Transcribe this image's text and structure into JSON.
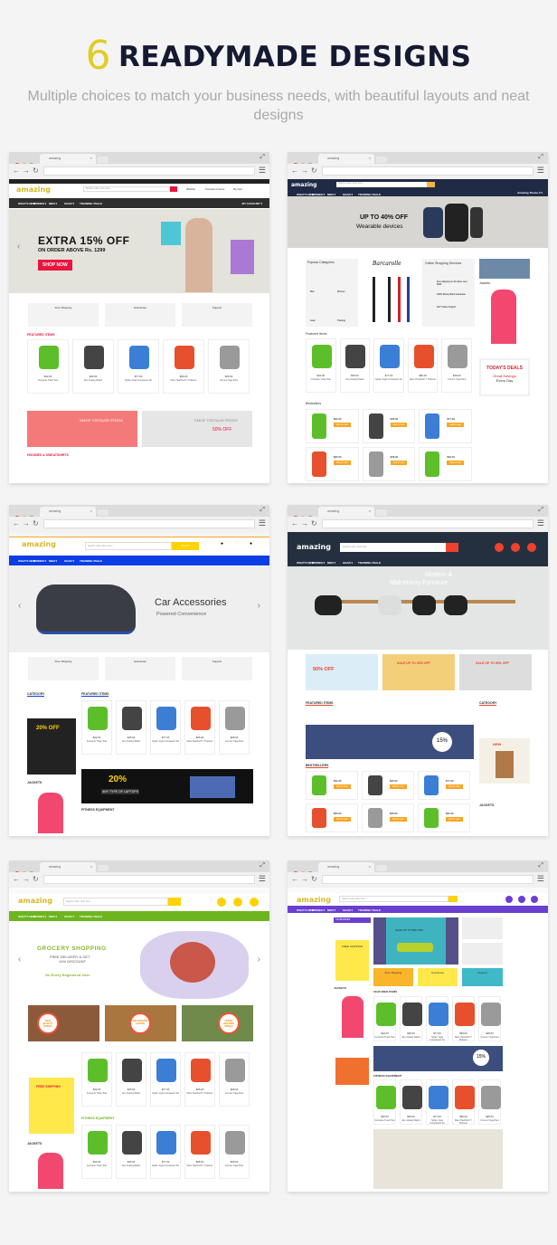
{
  "header": {
    "number": "6",
    "title": "READYMADE DESIGNS",
    "subtitle": "Multiple choices to match your business needs, with beautiful layouts and neat designs"
  },
  "browser": {
    "tab_title": "amazing",
    "dot_colors": [
      "#e7473f",
      "#f2b134",
      "#5dbc4d"
    ]
  },
  "nav_items": [
    "WHAT'S NEW",
    "WOMEN ▾",
    "MEN ▾",
    "GEAR ▾",
    "TRAINING ▾",
    "SALE"
  ],
  "logo": "amazing",
  "search_placeholder": "Search entire store here...",
  "products": [
    {
      "name": "Compete Track Tote",
      "price": "$32.00",
      "color": "#5cbf2a"
    },
    {
      "name": "Aim Analog Watch",
      "price": "$45.00",
      "color": "#444444"
    },
    {
      "name": "Sprite Yoga Companion Kit",
      "price": "$77.00",
      "color": "#3a7fd5"
    },
    {
      "name": "Mars HeatTech™ Pullover",
      "price": "$66.00",
      "color": "#e6502d"
    },
    {
      "name": "Cronus Yoga Pant",
      "price": "$28.00",
      "color": "#9a9a9a"
    }
  ],
  "designs": [
    {
      "accent": "#e8163e",
      "nav_bg": "#2f2f2f",
      "top_bar": "#222222",
      "my_account": "MY ACCOUNT ▾",
      "hero": {
        "line1": "EXTRA 15% OFF",
        "line2": "ON ORDER ABOVE Rs. 1299",
        "button": "SHOP NOW",
        "bg": "#e3e2db"
      },
      "header_links": [
        "Wishlist",
        "Compare 0 items",
        "My Cart"
      ],
      "features": [
        "Free Shipping",
        "Gaurantee",
        "Support"
      ],
      "sections": [
        "FEATURED ITEMS",
        "HOODIES & SWEATSHIRTS"
      ],
      "banners": [
        "SHOP VINTAGE FINDS",
        "SHOP VINTAGE FINDS"
      ],
      "banner_sale": "50% OFF"
    },
    {
      "accent": "#f6b53f",
      "nav_bg": "#1f2b45",
      "hero": {
        "line1": "UP TO 40% OFF",
        "line2": "Wearable devices",
        "bg": "#d8d6d2"
      },
      "theme_label": "Amazing Theme 2 ▾",
      "boxes": [
        "Popular Categories",
        "Barcarolle",
        "Online Shopping Services",
        "Jackets"
      ],
      "categories": [
        "Men",
        "Women",
        "Gear",
        "Training"
      ],
      "services": [
        "Free shipping on all orders over $100",
        "100% Money Back Gaurantee",
        "24/7 Online Support"
      ],
      "sections": [
        "Featured Items",
        "Bestsellers"
      ],
      "deals": {
        "title": "TODAY'S DEALS",
        "line1": "Great Savings",
        "line2": "Every Day"
      },
      "add_to_cart": "Add to Cart"
    },
    {
      "accent": "#ffd200",
      "nav_bg": "#0b3ee3",
      "search_button": "Search",
      "hero": {
        "line1": "Car Accessories",
        "line2": "Powered Convenience",
        "bg": "#efefef"
      },
      "features": [
        "Free Shipping",
        "Gaurantee",
        "Support"
      ],
      "sections": [
        "CATEGORY",
        "FEATURED ITEMS",
        "JACKETS",
        "FITNESS EQUIPMENT"
      ],
      "promo1": "20% OFF",
      "promo2": "20%",
      "promo3": "ANY TYPE OF LAPTOPS"
    },
    {
      "accent": "#f0412d",
      "nav_bg": "#24303f",
      "hero": {
        "line1": "Modern &",
        "line2": "Midcentury Furniture",
        "bg": "#e4e6e6"
      },
      "promos": [
        "50% OFF",
        "SALE UP TO 50% OFF",
        "SALE UP TO 50% OFF"
      ],
      "sections": [
        "FEATURED ITEMS",
        "CATEGORY",
        "BESTSELLERS",
        "JACKETS"
      ],
      "new_label": "NEW",
      "badge": "15%"
    },
    {
      "accent": "#ffd200",
      "nav_bg": "#6db51f",
      "hero": {
        "line1": "GROCERY SHOPPING",
        "line2": "FREE DELIVERY & GET",
        "line3": "10% DISCOUNT",
        "line4": "On Every Registered User",
        "bg": "#ffffff"
      },
      "spices": [
        "100% QUALITY SPICES",
        "THE BIGGEST CHOICE",
        "FRESH ORGANIC SPICES"
      ],
      "sections": [
        "FITNESS EQUIPMENT",
        "JACKETS"
      ],
      "free_shipping": "FREE SHIPPING"
    },
    {
      "accent": "#ffd200",
      "nav_bg": "#6a3fd0",
      "hero": {
        "line1": "SALE UP TO 50% OFF",
        "bg": "#3fb4c0"
      },
      "sidebar_title": "CATEGORIES",
      "free_shipping": "FREE SHIPPING",
      "features": [
        "Free Shipping",
        "Gaurantee",
        "Support"
      ],
      "sections": [
        "JACKETS",
        "FEATURED ITEMS",
        "FITNESS EQUIPMENT"
      ],
      "badge": "15%"
    }
  ]
}
